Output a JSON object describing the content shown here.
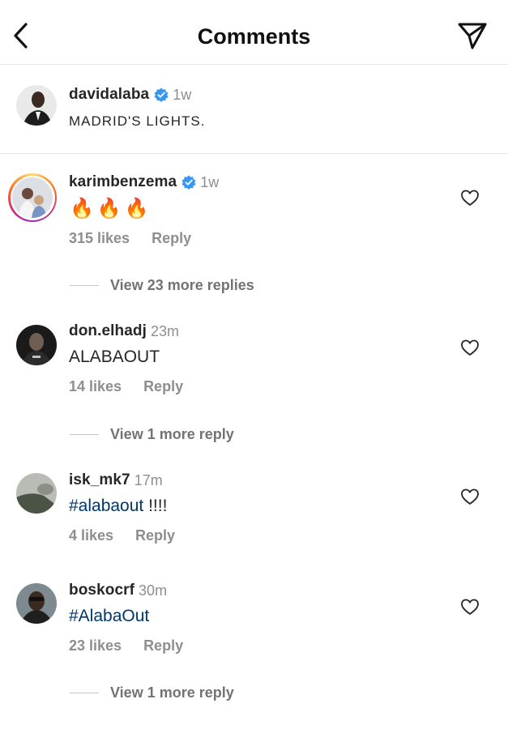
{
  "header": {
    "title": "Comments"
  },
  "caption": {
    "username": "davidalaba",
    "time": "1w",
    "text": "MADRID'S LIGHTS."
  },
  "comments": [
    {
      "username": "karimbenzema",
      "verified": true,
      "time": "1w",
      "text": "🔥🔥🔥",
      "likes": "315 likes",
      "reply_label": "Reply",
      "view_replies": "View 23 more replies"
    },
    {
      "username": "don.elhadj",
      "verified": false,
      "time": "23m",
      "text": "ALABAOUT",
      "likes": "14 likes",
      "reply_label": "Reply",
      "view_replies": "View 1 more reply"
    },
    {
      "username": "isk_mk7",
      "verified": false,
      "time": "17m",
      "hashtag": "#alabaout",
      "text_rest": " !!!!",
      "likes": "4 likes",
      "reply_label": "Reply"
    },
    {
      "username": "boskocrf",
      "verified": false,
      "time": "30m",
      "hashtag": "#AlabaOut",
      "likes": "23 likes",
      "reply_label": "Reply",
      "view_replies": "View 1 more reply"
    }
  ],
  "colors": {
    "verified": "#3897f0",
    "hashtag": "#00376b",
    "secondary_text": "#8e8e8e"
  },
  "icons": {
    "back": "chevron-left-icon",
    "share": "paper-plane-icon",
    "like": "heart-outline-icon",
    "verified": "verified-badge-icon"
  }
}
